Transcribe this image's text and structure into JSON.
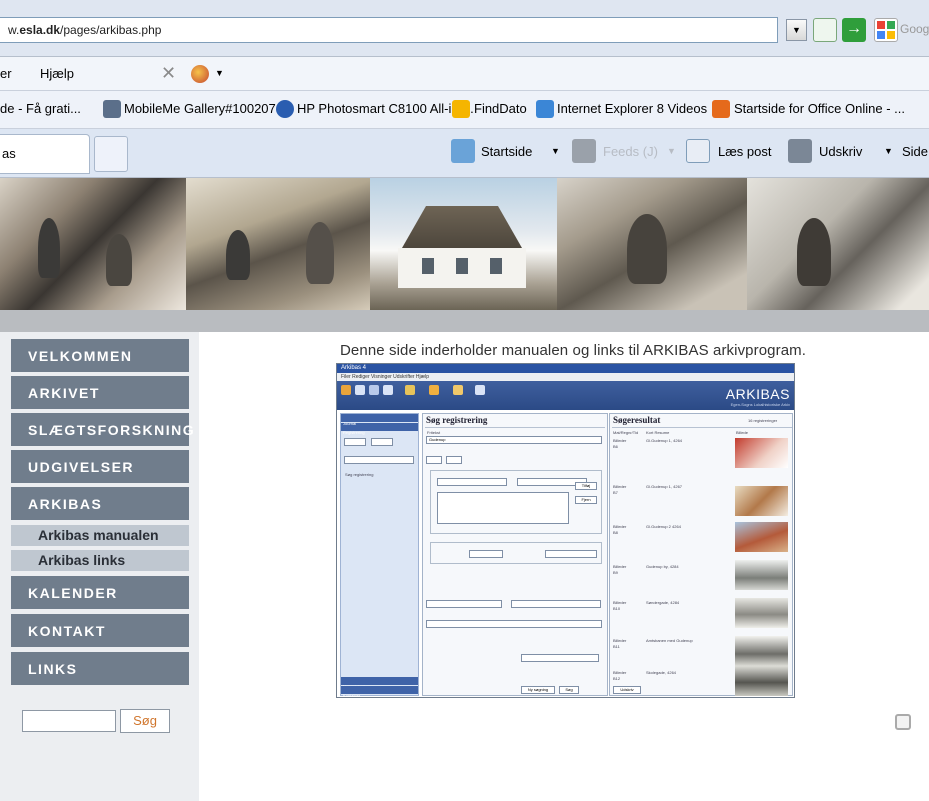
{
  "browser": {
    "address_prefix": "w.",
    "address_domain": "esla.dk",
    "address_path": "/pages/arkibas.php",
    "search_text": "Goog",
    "menu": {
      "item_partial": "er",
      "help": "Hjælp"
    },
    "favorites": [
      "de - Få grati...",
      "MobileMe Gallery#100207",
      "HP Photosmart C8100 All-in-...",
      "FindDato",
      "Internet Explorer 8 Videos",
      "Startside for Office Online - ..."
    ],
    "tab_label": "as",
    "commands": {
      "home": "Startside",
      "feeds": "Feeds (J)",
      "read_mail": "Læs post",
      "print": "Udskriv",
      "page": "Side"
    }
  },
  "nav": {
    "items": [
      "VELKOMMEN",
      "ARKIVET",
      "SLÆGTSFORSKNING",
      "UDGIVELSER",
      "ARKIBAS"
    ],
    "subitems": [
      "Arkibas manualen",
      "Arkibas links"
    ],
    "items_after": [
      "KALENDER",
      "KONTAKT",
      "LINKS"
    ],
    "search_button": "Søg"
  },
  "content": {
    "intro": "Denne side inderholder manualen og links til ARKIBAS arkivprogram."
  },
  "screenshot": {
    "window_title": "Arkibas 4",
    "menu": "Filer   Rediger   Visninger   Udskrifter   Hjælp",
    "brand": "ARKIBAS",
    "brand_sub": "Egen-Sogns Lokalhistoriske Arkiv",
    "search_title": "Søg registrering",
    "result_title": "Søgeresultat",
    "result_count": "16 registreringer",
    "left_items": [
      "Journal",
      "Registrering",
      "Søg registrering",
      "Ny registrering",
      "Kontakter"
    ],
    "fritekst_label": "Fritekst",
    "fritekst_value": "Gudenup",
    "columns": [
      "Mat/Regnr/Tid",
      "Kort Resume",
      "Billede"
    ],
    "rows": [
      {
        "type": "Billeder",
        "nr": "B6",
        "resume": "Gl.Gudenup 1, 4264"
      },
      {
        "type": "Billeder",
        "nr": "B7",
        "resume": "Gl.Gudenup 1, 4267"
      },
      {
        "type": "Billeder",
        "nr": "B8",
        "resume": "Gl.Gudenup 2 4264"
      },
      {
        "type": "Billeder",
        "nr": "B9",
        "resume": "Gudenup by, 4284"
      },
      {
        "type": "Billeder",
        "nr": "B10",
        "resume": "Søndergade, 4284"
      },
      {
        "type": "Billeder",
        "nr": "B11",
        "resume": "Amtsbanen med Gudenup"
      },
      {
        "type": "Billeder",
        "nr": "B12",
        "resume": "Skolegade, 4264"
      }
    ],
    "buttons": [
      "Tilføj",
      "Fjern",
      "Ny søgning",
      "Søg",
      "Udskriv"
    ]
  },
  "colors": {
    "nav_bg": "#707d8c",
    "subnav_bg": "#bfc7d0",
    "accent_orange": "#d0752c"
  }
}
